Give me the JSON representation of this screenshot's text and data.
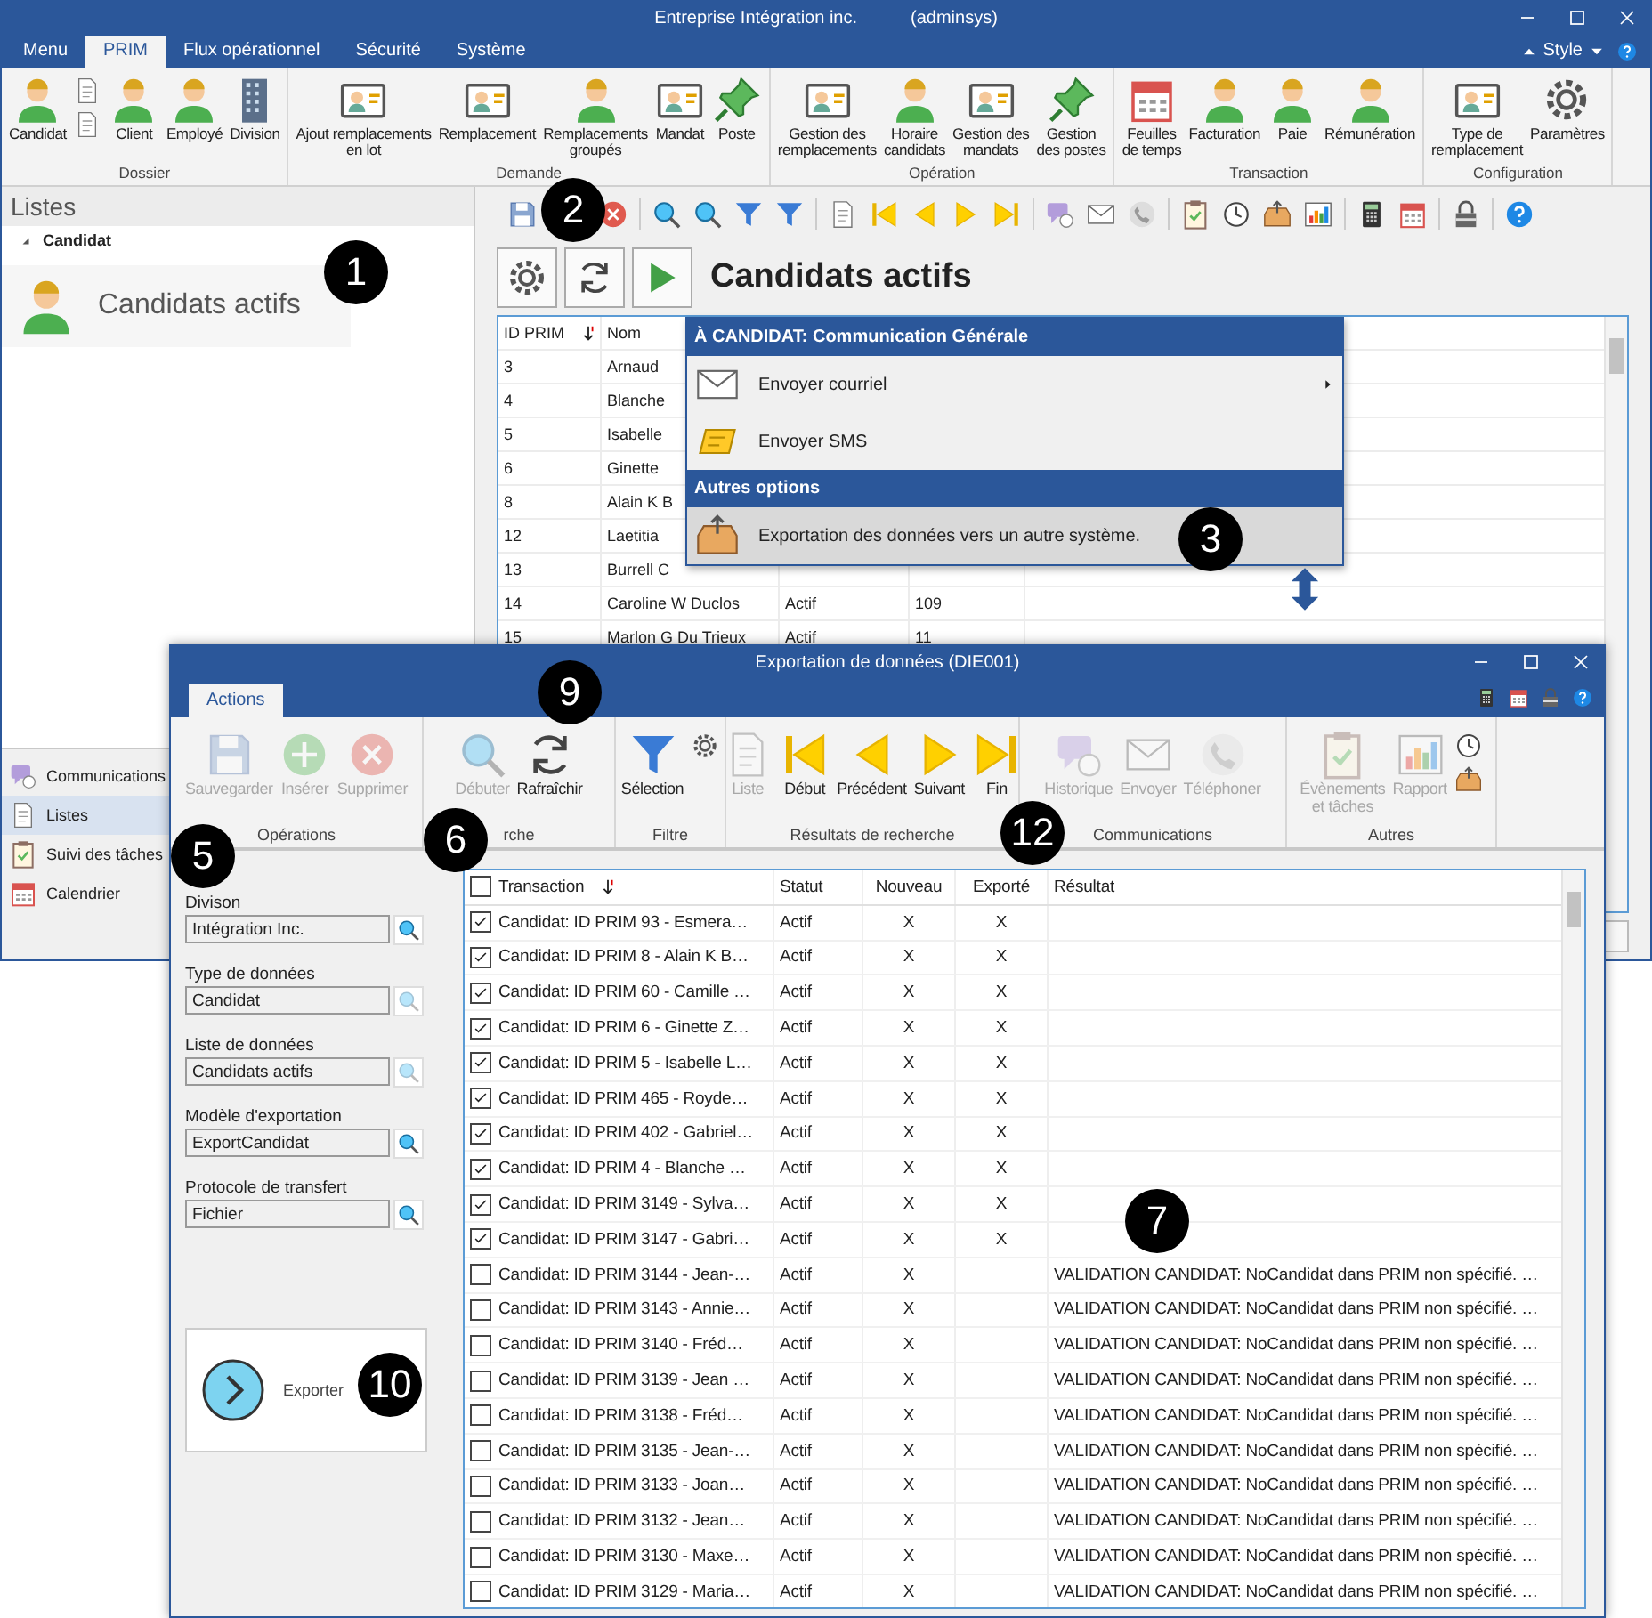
{
  "window": {
    "title": "Entreprise Intégration inc.",
    "user": "(adminsys)"
  },
  "menu_tabs": [
    {
      "label": "Menu",
      "selected": false
    },
    {
      "label": "PRIM",
      "selected": true
    },
    {
      "label": "Flux opérationnel",
      "selected": false
    },
    {
      "label": "Sécurité",
      "selected": false
    },
    {
      "label": "Système",
      "selected": false
    }
  ],
  "style_label": "Style",
  "ribbon": [
    {
      "group": "Dossier",
      "items": [
        {
          "kind": "large",
          "label": "Candidat"
        },
        {
          "kind": "small"
        },
        {
          "kind": "small"
        },
        {
          "kind": "large",
          "label": "Client"
        },
        {
          "kind": "large",
          "label": "Employé"
        },
        {
          "kind": "large",
          "label": "Division"
        }
      ]
    },
    {
      "group": "Demande",
      "items": [
        {
          "kind": "large",
          "label": "Ajout remplacements\nen lot"
        },
        {
          "kind": "large",
          "label": "Remplacement"
        },
        {
          "kind": "large",
          "label": "Remplacements\ngroupés"
        },
        {
          "kind": "large",
          "label": "Mandat"
        },
        {
          "kind": "large",
          "label": "Poste"
        }
      ]
    },
    {
      "group": "Opération",
      "items": [
        {
          "kind": "large",
          "label": "Gestion des\nremplacements"
        },
        {
          "kind": "large",
          "label": "Horaire\ncandidats"
        },
        {
          "kind": "large",
          "label": "Gestion des\nmandats"
        },
        {
          "kind": "large",
          "label": "Gestion\ndes postes"
        }
      ]
    },
    {
      "group": "Transaction",
      "items": [
        {
          "kind": "large",
          "label": "Feuilles\nde temps"
        },
        {
          "kind": "large",
          "label": "Facturation"
        },
        {
          "kind": "large",
          "label": "Paie"
        },
        {
          "kind": "large",
          "label": "Rémunération"
        }
      ]
    },
    {
      "group": "Configuration",
      "items": [
        {
          "kind": "large",
          "label": "Type de\nremplacement"
        },
        {
          "kind": "large",
          "label": "Paramètres"
        }
      ]
    }
  ],
  "lists_panel": {
    "title": "Listes",
    "tree_node": "Candidat",
    "item": "Candidats actifs"
  },
  "nav": [
    {
      "label": "Communications",
      "selected": false
    },
    {
      "label": "Listes",
      "selected": true
    },
    {
      "label": "Suivi des tâches",
      "selected": false
    },
    {
      "label": "Calendrier",
      "selected": false
    }
  ],
  "list_view": {
    "title": "Candidats actifs",
    "columns": [
      "ID PRIM",
      "Nom"
    ],
    "rows": [
      {
        "cells": [
          "3",
          "Arnaud"
        ]
      },
      {
        "cells": [
          "4",
          "Blanche"
        ]
      },
      {
        "cells": [
          "5",
          "Isabelle"
        ]
      },
      {
        "cells": [
          "6",
          "Ginette"
        ]
      },
      {
        "cells": [
          "8",
          "Alain K B"
        ]
      },
      {
        "cells": [
          "12",
          "Laetitia"
        ]
      },
      {
        "cells": [
          "13",
          "Burrell C"
        ]
      },
      {
        "cells": [
          "14",
          "Caroline W Duclos",
          "Actif",
          "109"
        ]
      },
      {
        "cells": [
          "15",
          "Marlon G Du Trieux",
          "Actif",
          "11"
        ]
      }
    ]
  },
  "context_menu": {
    "sections": [
      {
        "header": "À CANDIDAT: Communication Générale",
        "items": [
          {
            "label": "Envoyer courriel",
            "submenu": true,
            "selected": false
          },
          {
            "label": "Envoyer SMS",
            "submenu": false,
            "selected": false
          }
        ]
      },
      {
        "header": "Autres options",
        "items": [
          {
            "label": "Exportation des données vers un autre système.",
            "submenu": false,
            "selected": true
          }
        ]
      }
    ]
  },
  "dialog": {
    "title": "Exportation de données (DIE001)",
    "tabs": [
      {
        "label": "Actions",
        "selected": true
      }
    ],
    "ribbon": [
      {
        "group": "Opérations",
        "items": [
          {
            "kind": "large",
            "label": "Sauvegarder",
            "disabled": true
          },
          {
            "kind": "large",
            "label": "Insérer",
            "disabled": true
          },
          {
            "kind": "large",
            "label": "Supprimer",
            "disabled": true
          }
        ]
      },
      {
        "group": "rche",
        "items": [
          {
            "kind": "large",
            "label": "Débuter",
            "disabled": true
          },
          {
            "kind": "large",
            "label": "Rafraîchir",
            "disabled": false
          }
        ]
      },
      {
        "group": "Filtre",
        "items": [
          {
            "kind": "large",
            "label": "Sélection",
            "disabled": false
          },
          {
            "kind": "small",
            "disabled": false
          }
        ]
      },
      {
        "group": "Résultats de recherche",
        "items": [
          {
            "kind": "large",
            "label": "Liste",
            "disabled": true
          },
          {
            "kind": "large",
            "label": "Début",
            "disabled": false
          },
          {
            "kind": "large",
            "label": "Précédent",
            "disabled": false
          },
          {
            "kind": "large",
            "label": "Suivant",
            "disabled": false
          },
          {
            "kind": "large",
            "label": "Fin",
            "disabled": false
          }
        ]
      },
      {
        "group": "Communications",
        "items": [
          {
            "kind": "large",
            "label": "Historique",
            "disabled": true
          },
          {
            "kind": "large",
            "label": "Envoyer",
            "disabled": true
          },
          {
            "kind": "large",
            "label": "Téléphoner",
            "disabled": true
          }
        ]
      },
      {
        "group": "Autres",
        "items": [
          {
            "kind": "large",
            "label": "Évènements\net tâches",
            "disabled": true
          },
          {
            "kind": "large",
            "label": "Rapport",
            "disabled": true
          },
          {
            "kind": "small",
            "disabled": false
          },
          {
            "kind": "small",
            "disabled": false
          }
        ]
      }
    ],
    "form": [
      {
        "label": "Divison",
        "value": "Intégration Inc.",
        "disabled": false
      },
      {
        "label": "Type de données",
        "value": "Candidat",
        "disabled": true
      },
      {
        "label": "Liste de données",
        "value": "Candidats actifs",
        "disabled": true
      },
      {
        "label": "Modèle d'exportation",
        "value": "ExportCandidat",
        "disabled": false
      },
      {
        "label": "Protocole de transfert",
        "value": "Fichier",
        "disabled": false
      }
    ],
    "export_button": "Exporter",
    "grid": {
      "columns": [
        "Transaction",
        "Statut",
        "Nouveau",
        "Exporté",
        "Résultat"
      ],
      "select_all": {
        "checked": false
      },
      "rows": [
        {
          "checked": true,
          "transaction": "Candidat: ID PRIM 93 - Esmera…",
          "status": "Actif",
          "new": "X",
          "exported": "X"
        },
        {
          "checked": true,
          "transaction": "Candidat: ID PRIM 8 - Alain K B…",
          "status": "Actif",
          "new": "X",
          "exported": "X"
        },
        {
          "checked": true,
          "transaction": "Candidat: ID PRIM 60 - Camille …",
          "status": "Actif",
          "new": "X",
          "exported": "X"
        },
        {
          "checked": true,
          "transaction": "Candidat: ID PRIM 6 - Ginette Z…",
          "status": "Actif",
          "new": "X",
          "exported": "X"
        },
        {
          "checked": true,
          "transaction": "Candidat: ID PRIM 5 - Isabelle L…",
          "status": "Actif",
          "new": "X",
          "exported": "X"
        },
        {
          "checked": true,
          "transaction": "Candidat: ID PRIM 465 - Royde…",
          "status": "Actif",
          "new": "X",
          "exported": "X"
        },
        {
          "checked": true,
          "transaction": "Candidat: ID PRIM 402 - Gabriel…",
          "status": "Actif",
          "new": "X",
          "exported": "X"
        },
        {
          "checked": true,
          "transaction": "Candidat: ID PRIM 4 - Blanche …",
          "status": "Actif",
          "new": "X",
          "exported": "X"
        },
        {
          "checked": true,
          "transaction": "Candidat: ID PRIM 3149 - Sylva…",
          "status": "Actif",
          "new": "X",
          "exported": "X"
        },
        {
          "checked": true,
          "transaction": "Candidat: ID PRIM 3147 - Gabri…",
          "status": "Actif",
          "new": "X",
          "exported": "X"
        },
        {
          "checked": false,
          "transaction": "Candidat: ID PRIM 3144 - Jean-…",
          "status": "Actif",
          "new": "X",
          "result": "VALIDATION CANDIDAT: NoCandidat dans PRIM non spécifié. …"
        },
        {
          "checked": false,
          "transaction": "Candidat: ID PRIM 3143 - Annie…",
          "status": "Actif",
          "new": "X",
          "result": "VALIDATION CANDIDAT: NoCandidat dans PRIM non spécifié. …"
        },
        {
          "checked": false,
          "transaction": "Candidat: ID PRIM 3140 - Fréd…",
          "status": "Actif",
          "new": "X",
          "result": "VALIDATION CANDIDAT: NoCandidat dans PRIM non spécifié. …"
        },
        {
          "checked": false,
          "transaction": "Candidat: ID PRIM 3139 - Jean …",
          "status": "Actif",
          "new": "X",
          "result": "VALIDATION CANDIDAT: NoCandidat dans PRIM non spécifié. …"
        },
        {
          "checked": false,
          "transaction": "Candidat: ID PRIM 3138 - Fréd…",
          "status": "Actif",
          "new": "X",
          "result": "VALIDATION CANDIDAT: NoCandidat dans PRIM non spécifié. …"
        },
        {
          "checked": false,
          "transaction": "Candidat: ID PRIM 3135 - Jean-…",
          "status": "Actif",
          "new": "X",
          "result": "VALIDATION CANDIDAT: NoCandidat dans PRIM non spécifié. …"
        },
        {
          "checked": false,
          "transaction": "Candidat: ID PRIM 3133 - Joan…",
          "status": "Actif",
          "new": "X",
          "result": "VALIDATION CANDIDAT: NoCandidat dans PRIM non spécifié. …"
        },
        {
          "checked": false,
          "transaction": "Candidat: ID PRIM 3132 - Jean…",
          "status": "Actif",
          "new": "X",
          "result": "VALIDATION CANDIDAT: NoCandidat dans PRIM non spécifié. …"
        },
        {
          "checked": false,
          "transaction": "Candidat: ID PRIM 3130 - Maxe…",
          "status": "Actif",
          "new": "X",
          "result": "VALIDATION CANDIDAT: NoCandidat dans PRIM non spécifié. …"
        },
        {
          "checked": false,
          "transaction": "Candidat: ID PRIM 3129 - Maria…",
          "status": "Actif",
          "new": "X",
          "result": "VALIDATION CANDIDAT: NoCandidat dans PRIM non spécifié. …"
        }
      ]
    }
  },
  "callouts": [
    "1",
    "2",
    "3",
    "5",
    "6",
    "7",
    "9",
    "10",
    "12"
  ]
}
